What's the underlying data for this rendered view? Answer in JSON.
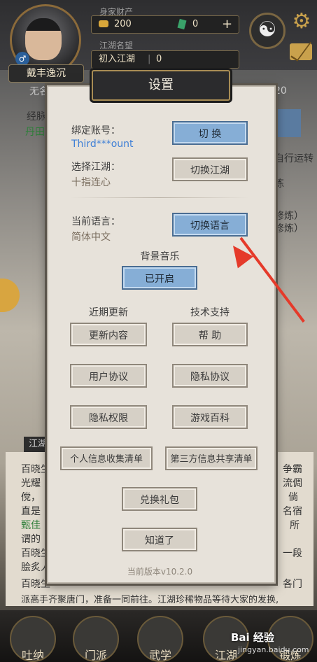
{
  "hud": {
    "wealth_label": "身家财产",
    "gold": "200",
    "jade": "0",
    "plus": "+",
    "fame_label": "江湖名望",
    "fame_title": "初入江湖",
    "fame_value": "0",
    "player_name": "戴丰逸沉",
    "gender_symbol": "♂",
    "taiji_symbol": "☯",
    "gear_symbol": "⚙"
  },
  "background": {
    "left_row1": "无名",
    "left_row2": "经脉",
    "left_row3": "丹田",
    "right_num": "20",
    "right_row1": "自行运转",
    "right_row2": "炼",
    "right_row3": "修炼）",
    "right_row4": "修炼）",
    "jianghu_tab": "江湖",
    "story1_left": "百晓生",
    "story1_right": "争霸",
    "story2_left": "光耀",
    "story2_right": "流倜",
    "story3_left": "傥，",
    "story3_right": "倘",
    "story4_left": "直是",
    "story4_right": "名宿",
    "story5_left": "甄佳",
    "story5_right": "所",
    "story6_left": "谓的",
    "story7_left": "百晓生",
    "story7_right": "一段",
    "story8_left": "脍炙人",
    "story9_left": "百晓生",
    "story9_right": "各门",
    "story10": "派高手齐聚唐门，准备一同前往。江湖珍稀物品等待大家的发换,"
  },
  "dialog": {
    "title": "设置",
    "bind_account_label": "绑定账号：",
    "bind_account_value": "Third***ount",
    "switch_button": "切 换",
    "choose_world_label": "选择江湖：",
    "choose_world_value": "十指连心",
    "switch_world_button": "切换江湖",
    "language_label": "当前语言：",
    "language_value": "简体中文",
    "switch_language_button": "切换语言",
    "music_label": "背景音乐",
    "music_button": "已开启",
    "recent_updates_label": "近期更新",
    "tech_support_label": "技术支持",
    "update_content_button": "更新内容",
    "help_button": "帮 助",
    "user_agreement_button": "用户协议",
    "privacy_agreement_button": "隐私协议",
    "privacy_permission_button": "隐私权限",
    "game_wiki_button": "游戏百科",
    "personal_info_button": "个人信息收集清单",
    "third_party_button": "第三方信息共享清单",
    "redeem_button": "兑换礼包",
    "ok_button": "知道了",
    "version": "当前版本v10.2.0"
  },
  "bottom_nav": [
    "吐纳",
    "门派",
    "武学",
    "江湖",
    "锻炼"
  ],
  "watermark": {
    "brand": "Bai 经验",
    "url": "jingyan.baidu.com"
  },
  "colors": {
    "accent_blue": "#86aed6",
    "panel": "#e7e2da",
    "arrow": "#e53a2a",
    "link": "#3e7fd6"
  }
}
